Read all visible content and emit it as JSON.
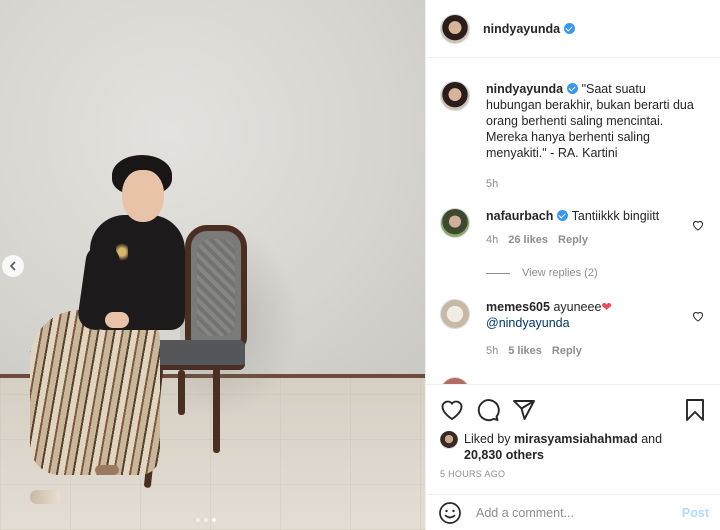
{
  "header": {
    "username": "nindyayunda"
  },
  "caption": {
    "username": "nindyayunda",
    "text": "\"Saat suatu hubungan berakhir, bukan berarti dua orang berhenti saling mencintai. Mereka hanya berhenti saling menyakiti.\" - RA. Kartini",
    "time": "5h"
  },
  "comments": [
    {
      "username": "nafaurbach",
      "text": "Tantiikkk bingiitt",
      "time": "4h",
      "likes": "26 likes",
      "reply": "Reply"
    },
    {
      "username": "memes605",
      "text": "ayuneee",
      "mention": "@nindyayunda",
      "emoji": "❤",
      "time": "5h",
      "likes": "5 likes",
      "reply": "Reply"
    }
  ],
  "view_replies": "View replies (2)",
  "likes": {
    "prefix": "Liked by",
    "user": "mirasyamsiahahmad",
    "and": "and",
    "others": "20,830 others"
  },
  "timestamp": "5 HOURS AGO",
  "add_comment": {
    "placeholder": "Add a comment...",
    "post_label": "Post"
  },
  "icons": {
    "like": "heart-outline-icon",
    "comment": "comment-bubble-icon",
    "share": "paper-plane-icon",
    "save": "bookmark-icon",
    "prev": "chevron-left-icon",
    "emoji": "smiley-icon",
    "verified": "verified-badge-icon"
  },
  "colors": {
    "verified": "#3897f0",
    "post_disabled": "#b3dbff",
    "muted": "#8e8e8e",
    "mention": "#00376b",
    "heart": "#ed4956"
  },
  "carousel": {
    "count": 3,
    "active_index": 2
  }
}
